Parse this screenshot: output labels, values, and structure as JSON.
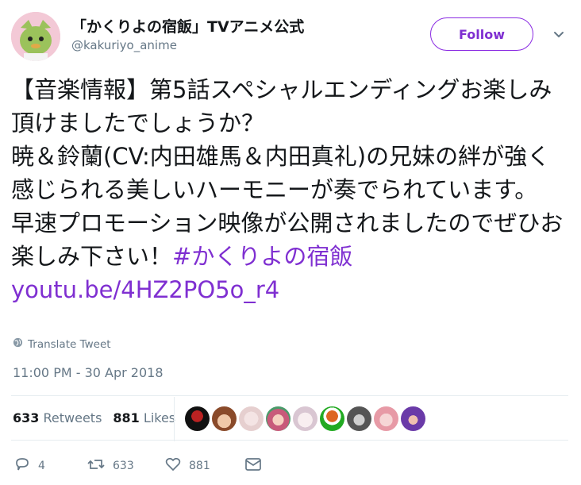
{
  "header": {
    "display_name": "「かくりよの宿飯」TVアニメ公式",
    "username": "@kakuriyo_anime",
    "follow_label": "Follow"
  },
  "tweet": {
    "text_before_link": "【音楽情報】第5話スペシャルエンディングお楽しみ頂けましたでしょうか？\n暁＆鈴蘭(CV:内田雄馬＆内田真礼)の兄妹の絆が強く感じられる美しいハーモニーが奏でられています。\n早速プロモーション映像が公開されましたのでぜひお楽しみ下さい！",
    "hashtag": "#かくりよの宿飯",
    "link": "youtu.be/4HZ2PO5o_r4",
    "translate_label": "Translate Tweet",
    "timestamp": "11:00 PM - 30 Apr 2018"
  },
  "stats": {
    "retweets_count": "633",
    "retweets_label": "Retweets",
    "likes_count": "881",
    "likes_label": "Likes"
  },
  "actions": {
    "reply_count": "4",
    "retweet_count": "633",
    "like_count": "881"
  },
  "colors": {
    "accent": "#7f2fd1",
    "secondary_text": "#657786"
  },
  "icons": [
    "globe-icon",
    "chevron-down-icon",
    "reply-icon",
    "retweet-icon",
    "heart-icon",
    "message-icon"
  ]
}
